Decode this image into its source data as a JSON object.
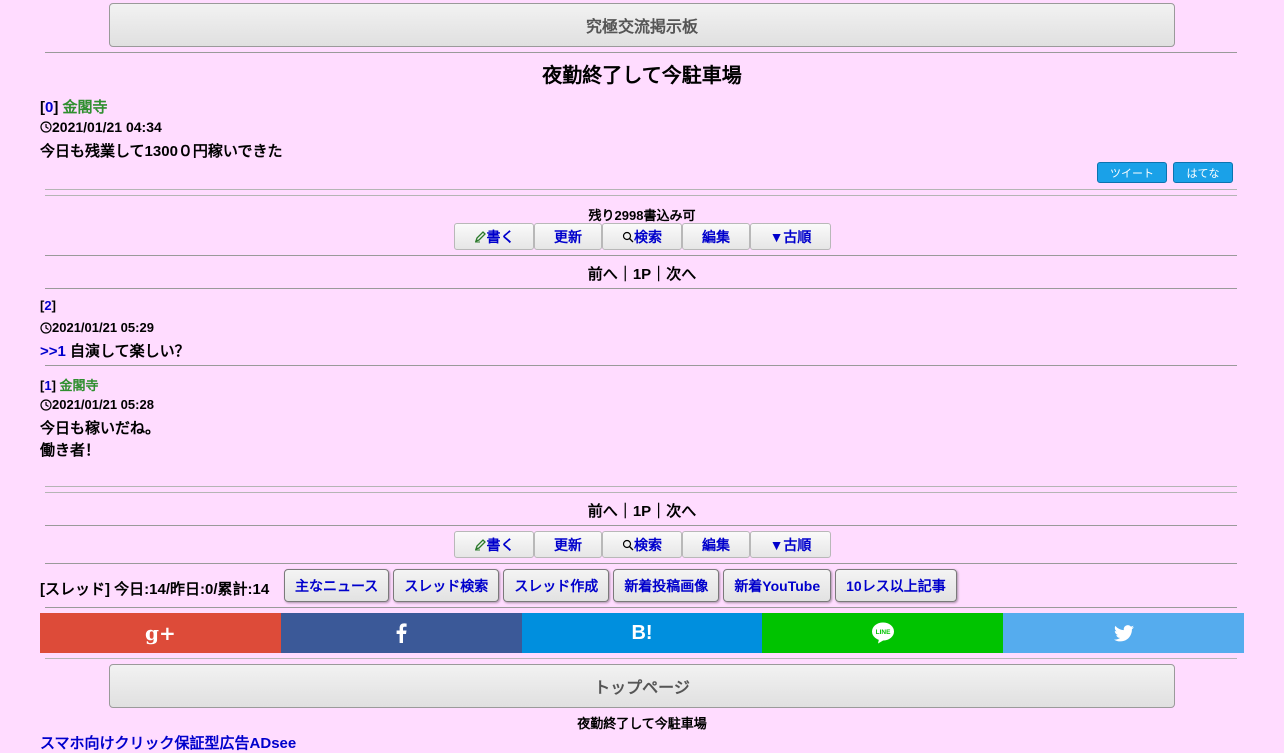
{
  "header": {
    "board_button": "究極交流掲示板"
  },
  "thread": {
    "title": "夜勤終了して今駐車場"
  },
  "first_post": {
    "num": "0",
    "name": "金閣寺",
    "date": "2021/01/21 04:34",
    "body": "今日も残業して1300０円稼いできた"
  },
  "share_small": {
    "tweet": "ツイート",
    "hatena": "はてな"
  },
  "remaining": "残り2998書込み可",
  "toolbar": {
    "write": "書く",
    "refresh": "更新",
    "search": "検索",
    "edit": "編集",
    "order": "▼古順"
  },
  "pager": {
    "prev": "前へ",
    "sep1": "｜",
    "page": "1P",
    "sep2": "｜",
    "next": "次へ"
  },
  "replies": [
    {
      "num": "2",
      "name": "",
      "date": "2021/01/21 05:29",
      "anchor": ">>1",
      "body_line1": "自演して楽しい？",
      "body_line2": ""
    },
    {
      "num": "1",
      "name": "金閣寺",
      "date": "2021/01/21 05:28",
      "anchor": "",
      "body_line1": "今日も稼いだね。",
      "body_line2": "働き者！"
    }
  ],
  "stats": {
    "label": "[スレッド] 今日:14/昨日:0/累計:14"
  },
  "nav_buttons": [
    "主なニュース",
    "スレッド検索",
    "スレッド作成",
    "新着投稿画像",
    "新着YouTube",
    "10レス以上記事"
  ],
  "social": {
    "colors": {
      "gplus": "#dd4b39",
      "facebook": "#3b5998",
      "hatena": "#008fde",
      "line": "#00c300",
      "twitter": "#55acee"
    },
    "hatena_label": "B!",
    "line_label": "LINE",
    "gplus_label": "g+"
  },
  "footer": {
    "top_button": "トップページ",
    "thread_title": "夜勤終了して今駐車場",
    "ad_link": "スマホ向けクリック保証型広告ADsee"
  }
}
